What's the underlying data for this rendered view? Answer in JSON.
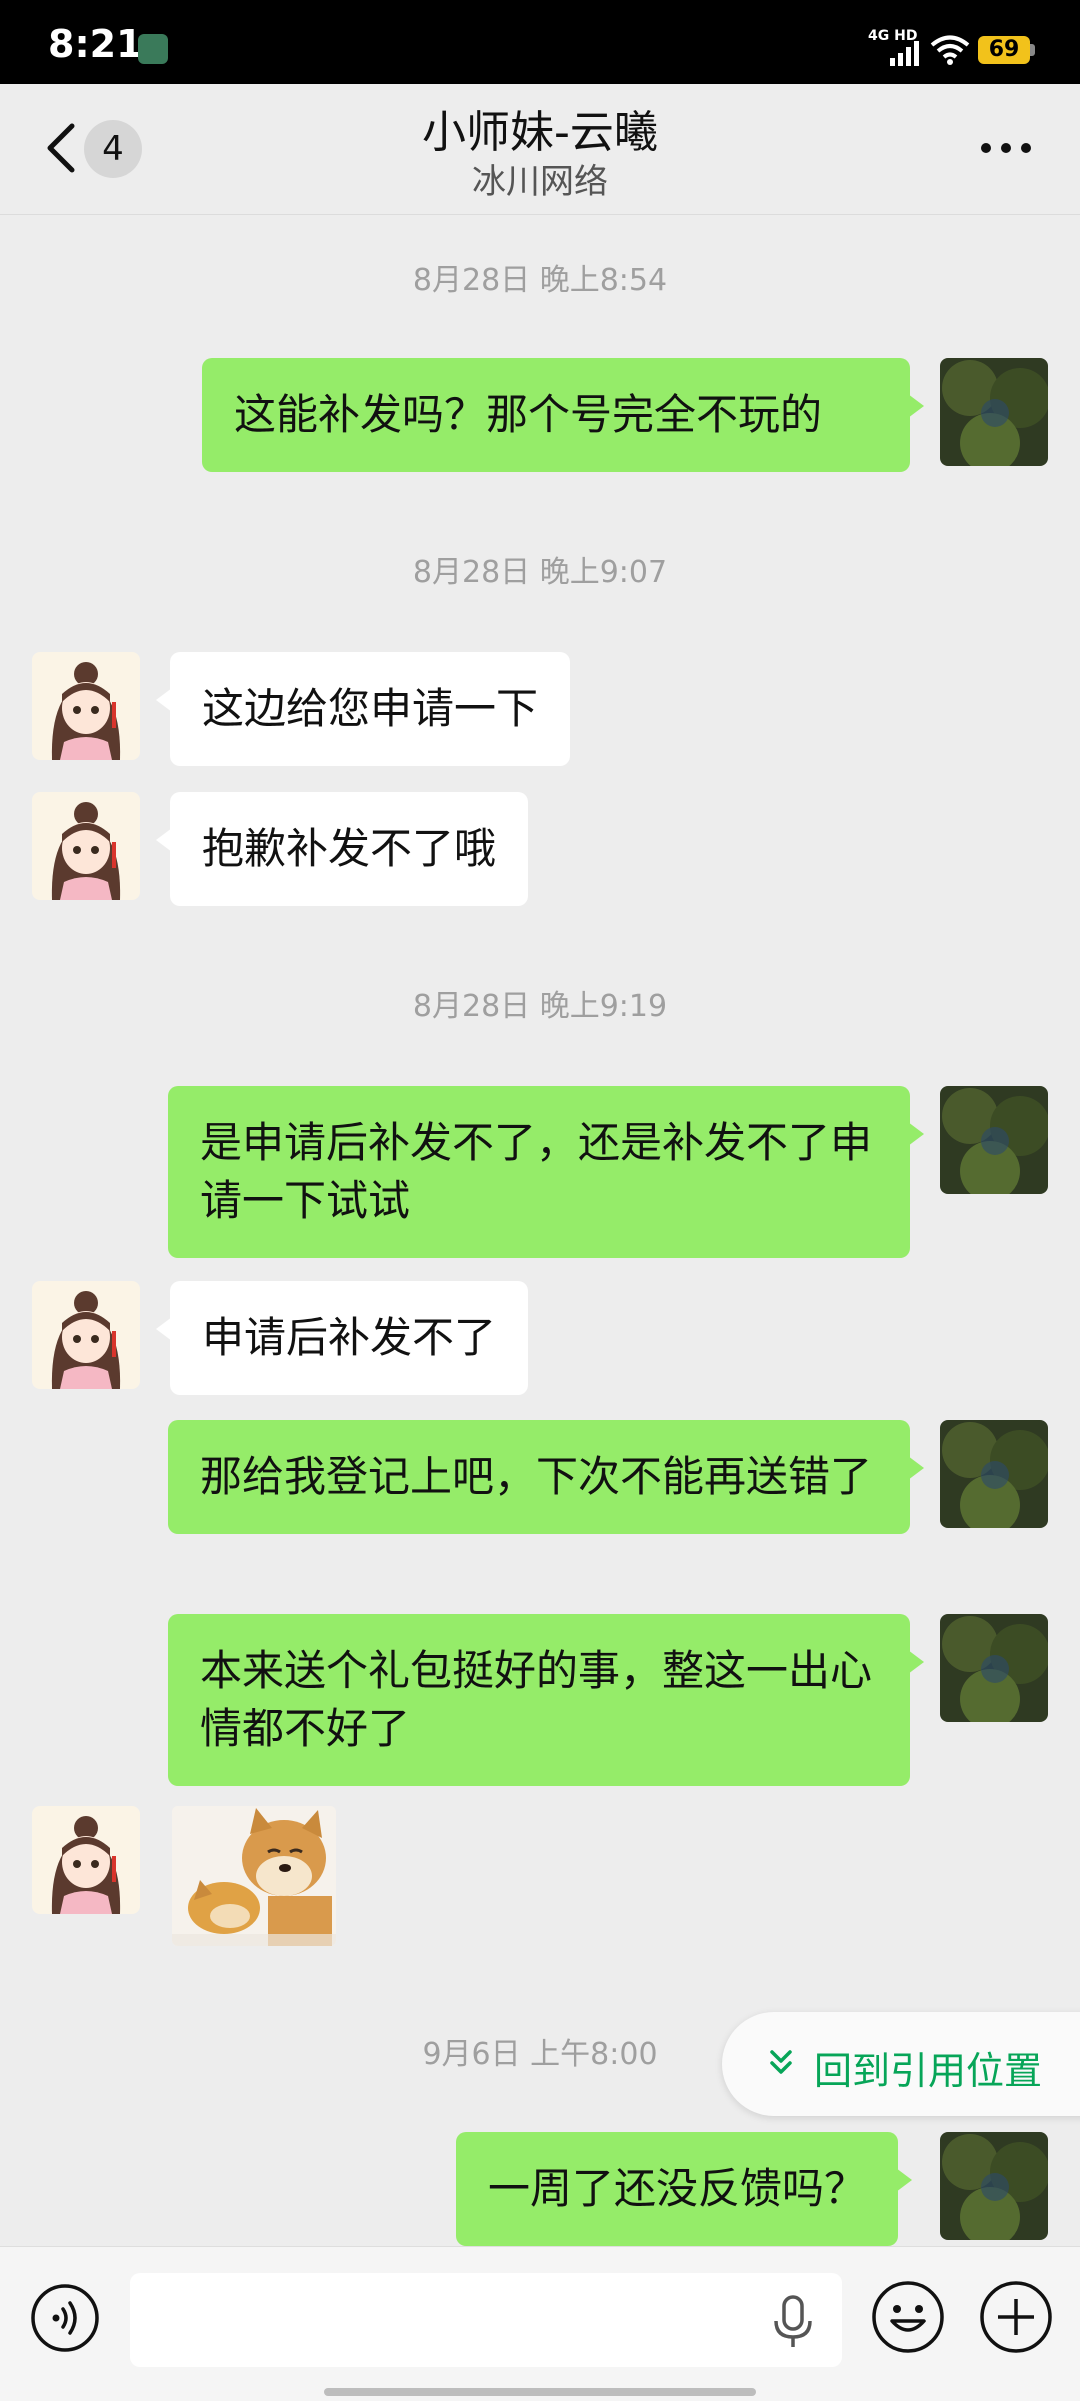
{
  "status_bar": {
    "time": "8:21",
    "network": "4G HD",
    "battery": "69"
  },
  "header": {
    "unread_count": "4",
    "title": "小师妹-云曦",
    "subtitle": "冰川网络"
  },
  "messages": [
    {
      "type": "timestamp",
      "text": "8月28日 晚上8:54"
    },
    {
      "type": "outgoing",
      "text": "这能补发吗？那个号完全不玩的"
    },
    {
      "type": "timestamp",
      "text": "8月28日 晚上9:07"
    },
    {
      "type": "incoming",
      "text": "这边给您申请一下"
    },
    {
      "type": "incoming",
      "text": "抱歉补发不了哦"
    },
    {
      "type": "timestamp",
      "text": "8月28日 晚上9:19"
    },
    {
      "type": "outgoing",
      "text": "是申请后补发不了，还是补发不了申请一下试试"
    },
    {
      "type": "incoming",
      "text": "申请后补发不了"
    },
    {
      "type": "outgoing",
      "text": "那给我登记上吧，下次不能再送错了"
    },
    {
      "type": "outgoing",
      "text": "本来送个礼包挺好的事，整这一出心情都不好了"
    },
    {
      "type": "incoming_sticker",
      "sticker": "shiba-dog-sticker"
    },
    {
      "type": "timestamp",
      "text": "9月6日 上午8:00"
    },
    {
      "type": "outgoing",
      "text": "一周了还没反馈吗？"
    }
  ],
  "jump_to_quote": {
    "label": "回到引用位置",
    "color": "#07a558"
  },
  "input_bar": {
    "placeholder": "",
    "voice_icon": "voice-icon",
    "mic_icon": "microphone-icon",
    "emoji_icon": "emoji-icon",
    "plus_icon": "plus-icon"
  },
  "colors": {
    "outgoing_bubble": "#95ec69",
    "incoming_bubble": "#ffffff",
    "background": "#ededed"
  }
}
